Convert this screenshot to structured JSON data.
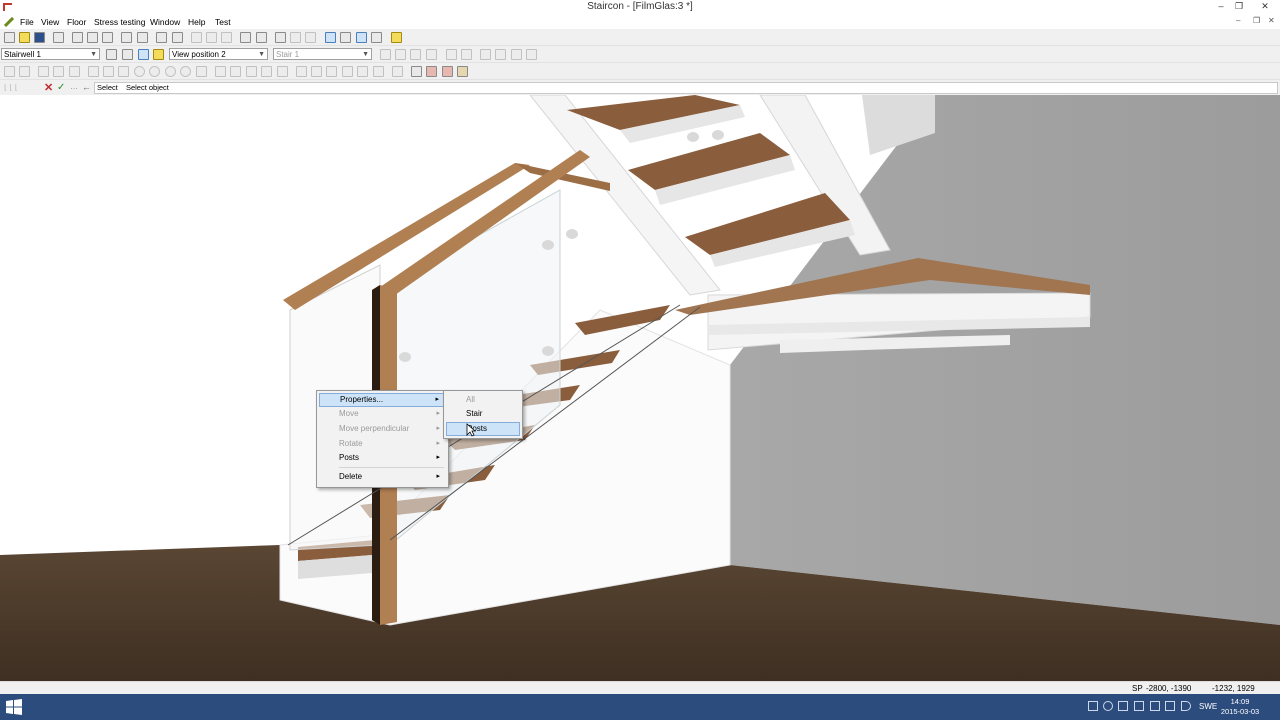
{
  "window": {
    "title": "Staircon - [FilmGlas:3 *]",
    "minimize": "–",
    "restore": "❐",
    "close": "✕"
  },
  "menu": [
    "File",
    "View",
    "Floor",
    "Stress testing",
    "Window",
    "Help",
    "Test"
  ],
  "toolbar2": {
    "stairwell": "Stairwell 1",
    "view_position": "View position 2",
    "stair": "Stair 1"
  },
  "cmdbar": {
    "mode": "Select",
    "prompt": "Select object"
  },
  "context_menu": {
    "items": [
      {
        "label": "Properties...",
        "enabled": true,
        "submenu": true,
        "highlighted": true
      },
      {
        "label": "Move",
        "enabled": false,
        "submenu": true
      },
      {
        "label": "Move perpendicular",
        "enabled": false,
        "submenu": true
      },
      {
        "label": "Rotate",
        "enabled": false,
        "submenu": true
      },
      {
        "label": "Posts",
        "enabled": true,
        "submenu": true
      },
      {
        "label": "Delete",
        "enabled": true,
        "submenu": true
      }
    ],
    "submenu": [
      {
        "label": "All",
        "enabled": false
      },
      {
        "label": "Stair",
        "enabled": true
      },
      {
        "label": "Posts",
        "enabled": true,
        "highlighted": true
      }
    ]
  },
  "status": {
    "sp_label": "SP",
    "coords1": "-2800, -1390",
    "coords2": "-1232, 1929"
  },
  "taskbar": {
    "lang": "SWE",
    "time": "14:09",
    "date": "2015-03-03"
  },
  "colors": {
    "wood": "#b07f52",
    "floor": "#4d3b2b",
    "wall_gray": "#a3a3a3",
    "menu_highlight": "#cde3f8",
    "taskbar": "#2c4c7e"
  }
}
